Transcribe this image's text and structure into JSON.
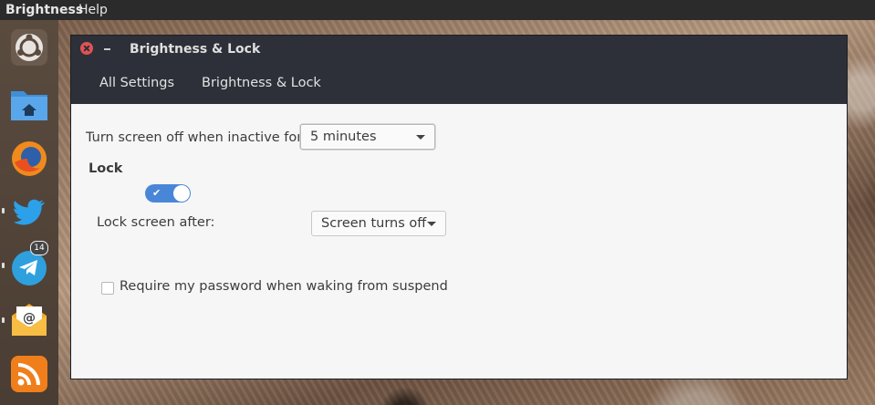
{
  "topbar": {
    "app_name": "Brightness",
    "menu_help": "Help"
  },
  "launcher": {
    "items": [
      {
        "name": "ubuntu-logo-icon"
      },
      {
        "name": "home-folder-icon"
      },
      {
        "name": "firefox-icon"
      },
      {
        "name": "twitter-icon"
      },
      {
        "name": "telegram-icon",
        "badge": "14"
      },
      {
        "name": "mail-icon"
      },
      {
        "name": "rss-feed-icon"
      }
    ]
  },
  "window": {
    "title": "Brightness & Lock",
    "breadcrumbs": [
      "All Settings",
      "Brightness & Lock"
    ]
  },
  "settings": {
    "screen_off_label": "Turn screen off when inactive for:",
    "screen_off_value": "5 minutes",
    "lock_heading": "Lock",
    "lock_enabled": true,
    "lock_after_label": "Lock screen after:",
    "lock_after_value": "Screen turns off",
    "require_password_label": "Require my password when waking from suspend",
    "require_password_checked": false
  },
  "colors": {
    "accent": "#4a86d8",
    "titlebar": "#2d3038",
    "close": "#e05355"
  }
}
